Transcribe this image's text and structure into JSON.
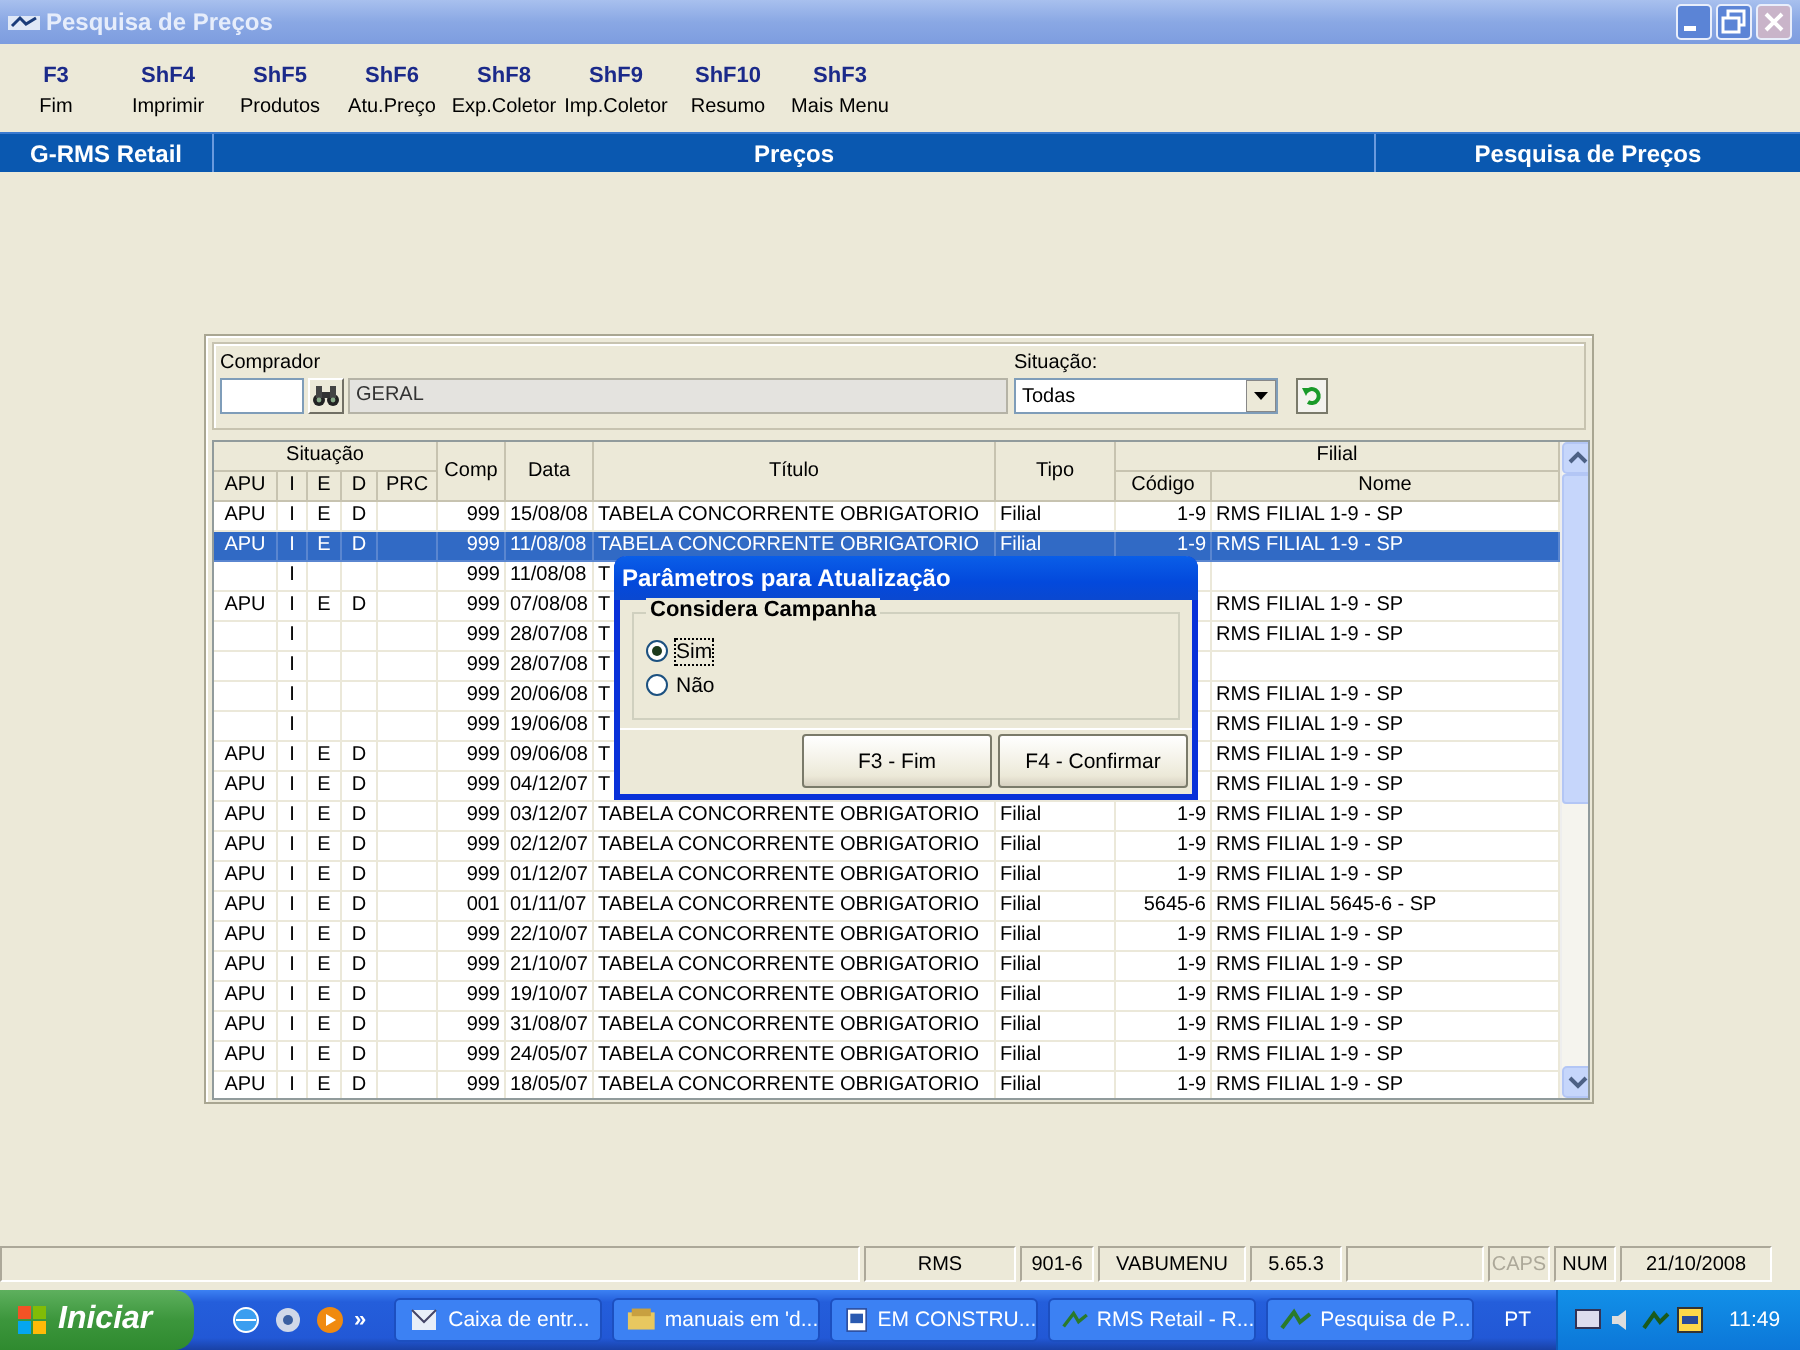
{
  "window": {
    "title": "Pesquisa de Preços"
  },
  "toolbar": [
    {
      "key": "F3",
      "label": "Fim"
    },
    {
      "key": "ShF4",
      "label": "Imprimir"
    },
    {
      "key": "ShF5",
      "label": "Produtos"
    },
    {
      "key": "ShF6",
      "label": "Atu.Preço"
    },
    {
      "key": "ShF8",
      "label": "Exp.Coletor"
    },
    {
      "key": "ShF9",
      "label": "Imp.Coletor"
    },
    {
      "key": "ShF10",
      "label": "Resumo"
    },
    {
      "key": "ShF3",
      "label": "Mais Menu"
    }
  ],
  "header_bar": {
    "left": "G-RMS Retail",
    "center": "Preços",
    "right": "Pesquisa de Preços"
  },
  "filter": {
    "comprador_label": "Comprador",
    "comprador_name": "GERAL",
    "situacao_label": "Situação:",
    "situacao_value": "Todas"
  },
  "table": {
    "column_groups": [
      {
        "label": "Situação"
      },
      {
        "label": "Filial"
      }
    ],
    "columns": [
      {
        "label": "APU",
        "grouped": true
      },
      {
        "label": "I",
        "grouped": true
      },
      {
        "label": "E",
        "grouped": true
      },
      {
        "label": "D",
        "grouped": true
      },
      {
        "label": "PRC",
        "grouped": true
      },
      {
        "label": "Comp",
        "grouped": false
      },
      {
        "label": "Data",
        "grouped": false
      },
      {
        "label": "Título",
        "grouped": false
      },
      {
        "label": "Tipo",
        "grouped": false
      },
      {
        "label": "Código",
        "grouped": true
      },
      {
        "label": "Nome",
        "grouped": true
      }
    ],
    "rows": [
      {
        "selected": false,
        "cells": [
          "APU",
          "I",
          "E",
          "D",
          null,
          "999",
          "15/08/08",
          "TABELA CONCORRENTE OBRIGATORIO",
          "Filial",
          "1-9",
          "RMS FILIAL 1-9 - SP"
        ]
      },
      {
        "selected": true,
        "cells": [
          "APU",
          "I",
          "E",
          "D",
          null,
          "999",
          "11/08/08",
          "TABELA CONCORRENTE OBRIGATORIO",
          "Filial",
          "1-9",
          "RMS FILIAL 1-9 - SP"
        ]
      },
      {
        "selected": false,
        "cells": [
          null,
          "I",
          null,
          null,
          null,
          "999",
          "11/08/08",
          "T",
          null,
          null,
          null
        ]
      },
      {
        "selected": false,
        "cells": [
          "APU",
          "I",
          "E",
          "D",
          null,
          "999",
          "07/08/08",
          "T",
          null,
          null,
          "RMS FILIAL 1-9 - SP"
        ]
      },
      {
        "selected": false,
        "cells": [
          null,
          "I",
          null,
          null,
          null,
          "999",
          "28/07/08",
          "T",
          null,
          null,
          "RMS FILIAL 1-9 - SP"
        ]
      },
      {
        "selected": false,
        "cells": [
          null,
          "I",
          null,
          null,
          null,
          "999",
          "28/07/08",
          "T",
          null,
          null,
          null
        ]
      },
      {
        "selected": false,
        "cells": [
          null,
          "I",
          null,
          null,
          null,
          "999",
          "20/06/08",
          "T",
          null,
          null,
          "RMS FILIAL 1-9 - SP"
        ]
      },
      {
        "selected": false,
        "cells": [
          null,
          "I",
          null,
          null,
          null,
          "999",
          "19/06/08",
          "T",
          null,
          null,
          "RMS FILIAL 1-9 - SP"
        ]
      },
      {
        "selected": false,
        "cells": [
          "APU",
          "I",
          "E",
          "D",
          null,
          "999",
          "09/06/08",
          "T",
          null,
          null,
          "RMS FILIAL 1-9 - SP"
        ]
      },
      {
        "selected": false,
        "cells": [
          "APU",
          "I",
          "E",
          "D",
          null,
          "999",
          "04/12/07",
          "T",
          null,
          null,
          "RMS FILIAL 1-9 - SP"
        ]
      },
      {
        "selected": false,
        "cells": [
          "APU",
          "I",
          "E",
          "D",
          null,
          "999",
          "03/12/07",
          "TABELA CONCORRENTE OBRIGATORIO",
          "Filial",
          "1-9",
          "RMS FILIAL 1-9 - SP"
        ]
      },
      {
        "selected": false,
        "cells": [
          "APU",
          "I",
          "E",
          "D",
          null,
          "999",
          "02/12/07",
          "TABELA CONCORRENTE OBRIGATORIO",
          "Filial",
          "1-9",
          "RMS FILIAL 1-9 - SP"
        ]
      },
      {
        "selected": false,
        "cells": [
          "APU",
          "I",
          "E",
          "D",
          null,
          "999",
          "01/12/07",
          "TABELA CONCORRENTE OBRIGATORIO",
          "Filial",
          "1-9",
          "RMS FILIAL 1-9 - SP"
        ]
      },
      {
        "selected": false,
        "cells": [
          "APU",
          "I",
          "E",
          "D",
          null,
          "001",
          "01/11/07",
          "TABELA CONCORRENTE OBRIGATORIO",
          "Filial",
          "5645-6",
          "RMS FILIAL 5645-6 - SP"
        ]
      },
      {
        "selected": false,
        "cells": [
          "APU",
          "I",
          "E",
          "D",
          null,
          "999",
          "22/10/07",
          "TABELA CONCORRENTE OBRIGATORIO",
          "Filial",
          "1-9",
          "RMS FILIAL 1-9 - SP"
        ]
      },
      {
        "selected": false,
        "cells": [
          "APU",
          "I",
          "E",
          "D",
          null,
          "999",
          "21/10/07",
          "TABELA CONCORRENTE OBRIGATORIO",
          "Filial",
          "1-9",
          "RMS FILIAL 1-9 - SP"
        ]
      },
      {
        "selected": false,
        "cells": [
          "APU",
          "I",
          "E",
          "D",
          null,
          "999",
          "19/10/07",
          "TABELA CONCORRENTE OBRIGATORIO",
          "Filial",
          "1-9",
          "RMS FILIAL 1-9 - SP"
        ]
      },
      {
        "selected": false,
        "cells": [
          "APU",
          "I",
          "E",
          "D",
          null,
          "999",
          "31/08/07",
          "TABELA CONCORRENTE OBRIGATORIO",
          "Filial",
          "1-9",
          "RMS FILIAL 1-9 - SP"
        ]
      },
      {
        "selected": false,
        "cells": [
          "APU",
          "I",
          "E",
          "D",
          null,
          "999",
          "24/05/07",
          "TABELA CONCORRENTE OBRIGATORIO",
          "Filial",
          "1-9",
          "RMS FILIAL 1-9 - SP"
        ]
      },
      {
        "selected": false,
        "cells": [
          "APU",
          "I",
          "E",
          "D",
          null,
          "999",
          "18/05/07",
          "TABELA CONCORRENTE OBRIGATORIO",
          "Filial",
          "1-9",
          "RMS FILIAL 1-9 - SP"
        ]
      }
    ]
  },
  "dialog": {
    "title": "Parâmetros para Atualização",
    "group_label": "Considera Campanha",
    "options": [
      {
        "label": "Sim",
        "selected": true
      },
      {
        "label": "Não",
        "selected": false
      }
    ],
    "buttons": [
      "F3 - Fim",
      "F4 - Confirmar"
    ]
  },
  "status_bar": [
    {
      "kind": "blank"
    },
    {
      "kind": "text",
      "text": "RMS",
      "disabled": false
    },
    {
      "kind": "text",
      "text": "901-6",
      "disabled": false
    },
    {
      "kind": "text",
      "text": "VABUMENU",
      "disabled": false
    },
    {
      "kind": "text",
      "text": "5.65.3",
      "disabled": false
    },
    {
      "kind": "blank"
    },
    {
      "kind": "text",
      "text": "CAPS",
      "disabled": true
    },
    {
      "kind": "text",
      "text": "NUM",
      "disabled": false
    },
    {
      "kind": "text",
      "text": "21/10/2008",
      "disabled": false
    }
  ],
  "taskbar": {
    "start": "Iniciar",
    "overflow": "»",
    "tasks": [
      {
        "label": "Caixa de entr..."
      },
      {
        "label": "manuais em 'd..."
      },
      {
        "label": "EM CONSTRU..."
      },
      {
        "label": "RMS Retail - R..."
      },
      {
        "label": "Pesquisa de P..."
      }
    ],
    "language": "PT",
    "clock": "11:49"
  }
}
